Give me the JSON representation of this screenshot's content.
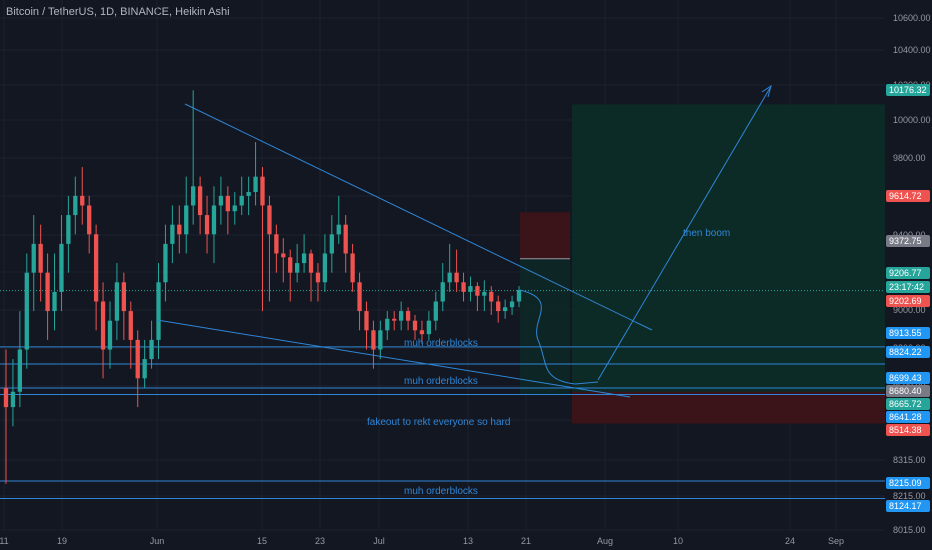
{
  "header": {
    "title": "Bitcoin / TetherUS, 1D, BINANCE, Heikin Ashi"
  },
  "colors": {
    "background": "#131722",
    "up": "#26a69a",
    "down": "#ef5350",
    "line": "#2f86d6",
    "target_zone": "#0c2b27",
    "stop_zone": "#3a1418",
    "grid": "#1e222d"
  },
  "price_axis": {
    "ticks": [
      "10600.00",
      "10400.00",
      "10200.00",
      "10000.00",
      "9800.00",
      "9600.00",
      "9400.00",
      "9200.00",
      "9000.00",
      "8800.00",
      "8600.00",
      "8415.00",
      "8315.00",
      "8215.00",
      "8015.00"
    ],
    "badges": [
      {
        "label": "10176.32",
        "color": "#26a69a"
      },
      {
        "label": "9614.72",
        "color": "#ef5350"
      },
      {
        "label": "9372.75",
        "color": "#787b86"
      },
      {
        "label": "9206.77",
        "color": "#26a69a"
      },
      {
        "label": "23:17:42",
        "color": "#26a69a"
      },
      {
        "label": "9202.69",
        "color": "#ef5350"
      },
      {
        "label": "8913.55",
        "color": "#2196f3"
      },
      {
        "label": "8824.22",
        "color": "#2196f3"
      },
      {
        "label": "8699.43",
        "color": "#2196f3"
      },
      {
        "label": "8680.40",
        "color": "#787b86"
      },
      {
        "label": "8665.72",
        "color": "#26a69a"
      },
      {
        "label": "8641.28",
        "color": "#2196f3"
      },
      {
        "label": "8514.38",
        "color": "#ef5350"
      },
      {
        "label": "8215.09",
        "color": "#2196f3"
      },
      {
        "label": "8124.17",
        "color": "#2196f3"
      }
    ]
  },
  "time_axis": {
    "ticks": [
      "11",
      "19",
      "Jun",
      "15",
      "23",
      "Jul",
      "13",
      "21",
      "Aug",
      "10",
      "24",
      "Sep"
    ]
  },
  "annotations": {
    "then_boom": "then boom",
    "orderblocks_1": "muh orderblocks",
    "orderblocks_2": "muh orderblocks",
    "orderblocks_3": "muh orderblocks",
    "fakeout": "fakeout to rekt everyone so hard"
  },
  "chart_data": {
    "type": "candlestick",
    "symbol": "Bitcoin / TetherUS, 1D, BINANCE, Heikin Ashi",
    "ylim": [
      7960,
      10720
    ],
    "x_labels": [
      "11",
      "19",
      "Jun",
      "15",
      "23",
      "Jul",
      "13",
      "21",
      "Aug",
      "10",
      "24",
      "Sep"
    ],
    "candles": [
      [
        8700,
        8600,
        8900,
        8200
      ],
      [
        8600,
        8680,
        8850,
        8500
      ],
      [
        8680,
        8900,
        9100,
        8600
      ],
      [
        8900,
        9300,
        9400,
        8800
      ],
      [
        9300,
        9450,
        9600,
        9100
      ],
      [
        9450,
        9300,
        9550,
        9150
      ],
      [
        9300,
        9100,
        9400,
        8950
      ],
      [
        9100,
        9200,
        9400,
        9000
      ],
      [
        9200,
        9450,
        9600,
        9100
      ],
      [
        9450,
        9600,
        9700,
        9300
      ],
      [
        9600,
        9700,
        9800,
        9500
      ],
      [
        9700,
        9650,
        9850,
        9550
      ],
      [
        9650,
        9500,
        9700,
        9400
      ],
      [
        9500,
        9150,
        9550,
        9000
      ],
      [
        9150,
        8900,
        9250,
        8750
      ],
      [
        8900,
        9050,
        9150,
        8800
      ],
      [
        9050,
        9250,
        9350,
        8950
      ],
      [
        9250,
        9100,
        9300,
        8950
      ],
      [
        9100,
        8950,
        9150,
        8800
      ],
      [
        8950,
        8750,
        9000,
        8600
      ],
      [
        8750,
        8850,
        8950,
        8700
      ],
      [
        8850,
        8950,
        9050,
        8800
      ],
      [
        8950,
        9250,
        9350,
        8850
      ],
      [
        9250,
        9450,
        9550,
        9150
      ],
      [
        9450,
        9550,
        9650,
        9350
      ],
      [
        9550,
        9500,
        9650,
        9400
      ],
      [
        9500,
        9650,
        9800,
        9400
      ],
      [
        9650,
        9750,
        10250,
        9550
      ],
      [
        9750,
        9600,
        9800,
        9500
      ],
      [
        9600,
        9500,
        9700,
        9400
      ],
      [
        9500,
        9650,
        9750,
        9350
      ],
      [
        9650,
        9700,
        9800,
        9550
      ],
      [
        9700,
        9620,
        9750,
        9500
      ],
      [
        9620,
        9650,
        9720,
        9550
      ],
      [
        9650,
        9700,
        9800,
        9600
      ],
      [
        9700,
        9720,
        9800,
        9600
      ],
      [
        9720,
        9800,
        9980,
        9650
      ],
      [
        9800,
        9650,
        9850,
        9100
      ],
      [
        9650,
        9500,
        9700,
        9150
      ],
      [
        9500,
        9400,
        9550,
        9300
      ],
      [
        9400,
        9380,
        9480,
        9250
      ],
      [
        9380,
        9300,
        9420,
        9150
      ],
      [
        9300,
        9350,
        9450,
        9250
      ],
      [
        9350,
        9400,
        9500,
        9300
      ],
      [
        9400,
        9300,
        9420,
        9150
      ],
      [
        9300,
        9250,
        9350,
        9150
      ],
      [
        9250,
        9400,
        9500,
        9200
      ],
      [
        9400,
        9500,
        9600,
        9300
      ],
      [
        9500,
        9550,
        9700,
        9450
      ],
      [
        9550,
        9400,
        9600,
        9300
      ],
      [
        9400,
        9250,
        9450,
        9200
      ],
      [
        9250,
        9100,
        9300,
        9000
      ],
      [
        9100,
        9000,
        9150,
        8900
      ],
      [
        9000,
        8900,
        9050,
        8800
      ],
      [
        8900,
        9000,
        9050,
        8850
      ],
      [
        9000,
        9060,
        9100,
        8950
      ],
      [
        9060,
        9050,
        9100,
        9000
      ],
      [
        9050,
        9100,
        9150,
        9000
      ],
      [
        9100,
        9050,
        9120,
        9000
      ],
      [
        9050,
        9000,
        9080,
        8950
      ],
      [
        9000,
        8980,
        9050,
        8930
      ],
      [
        8980,
        9050,
        9100,
        8950
      ],
      [
        9050,
        9150,
        9200,
        9000
      ],
      [
        9150,
        9250,
        9350,
        9100
      ],
      [
        9250,
        9300,
        9450,
        9200
      ],
      [
        9300,
        9250,
        9420,
        9200
      ],
      [
        9250,
        9200,
        9300,
        9150
      ],
      [
        9200,
        9230,
        9280,
        9150
      ],
      [
        9230,
        9180,
        9250,
        9100
      ],
      [
        9180,
        9200,
        9260,
        9100
      ],
      [
        9200,
        9150,
        9230,
        9080
      ],
      [
        9150,
        9100,
        9180,
        9040
      ],
      [
        9100,
        9120,
        9160,
        9060
      ],
      [
        9120,
        9150,
        9180,
        9080
      ],
      [
        9150,
        9210,
        9230,
        9120
      ]
    ],
    "horizontal_lines": [
      8913.55,
      8824.22,
      8699.43,
      8665.72,
      8215.09,
      8124.17
    ],
    "price_badges": [
      10176.32,
      9614.72,
      9372.75,
      9206.77,
      9202.69,
      8913.55,
      8824.22,
      8699.43,
      8680.4,
      8665.72,
      8641.28,
      8514.38,
      8215.09,
      8124.17
    ],
    "countdown": "23:17:42",
    "target_zone": [
      8665.72,
      10176.32
    ],
    "stop_zone": [
      8514.38,
      8680.4
    ],
    "upper_zone": [
      9372.75,
      9614.72
    ]
  }
}
